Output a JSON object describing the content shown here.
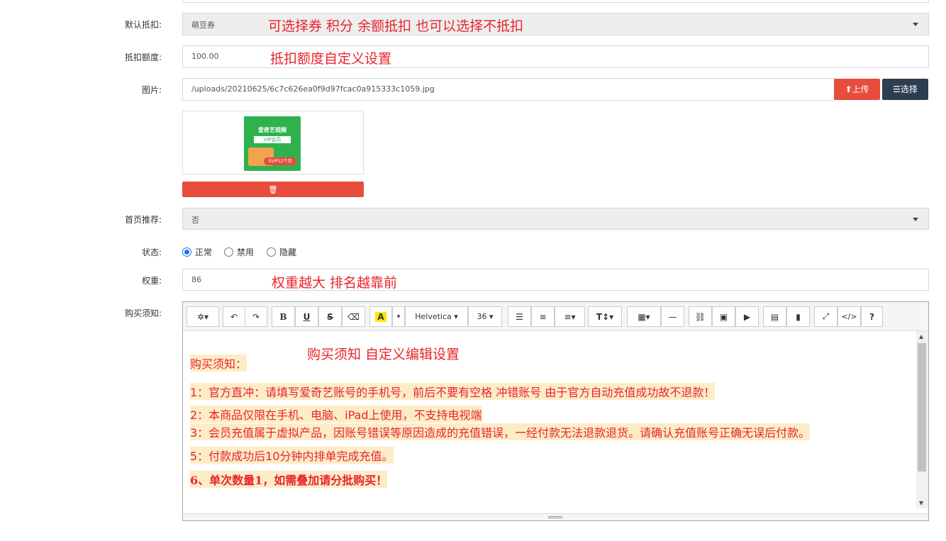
{
  "deduct": {
    "label": "默认抵扣:",
    "value": "萌豆券",
    "note": "可选择券  积分 余额抵扣  也可以选择不抵扣"
  },
  "amount": {
    "label": "抵扣额度:",
    "value": "100.00",
    "note": "抵扣额度自定义设置"
  },
  "image": {
    "label": "图片:",
    "path": "/uploads/20210625/6c7c626ea0f9d97fcac0a915333c1059.jpg",
    "upload_label": "上传",
    "choose_label": "选择",
    "thumb_lines": [
      "爱奇艺视频",
      "VIP会员",
      "SVIP12个月"
    ]
  },
  "recommend": {
    "label": "首页推荐:",
    "value": "否"
  },
  "status": {
    "label": "状态:",
    "options": [
      "正常",
      "禁用",
      "隐藏"
    ],
    "selected": "正常"
  },
  "weight": {
    "label": "权重:",
    "value": "86",
    "note": "权重越大 排名越靠前"
  },
  "notice": {
    "label": "购买须知:",
    "toolbar": {
      "font": "Helvetica",
      "size": "36",
      "bold": "B",
      "underline": "U",
      "strike": "S",
      "highlight": "A",
      "help": "?"
    },
    "annotation": "购买须知   自定义编辑设置",
    "lines": [
      "购买须知：",
      "1：官方直冲：请填写爱奇艺账号的手机号，前后不要有空格 冲错账号 由于官方自动充值成功故不退款！",
      "2：本商品仅限在手机、电脑、iPad上使用，不支持电视端",
      "3：会员充值属于虚拟产品，因账号错误等原因造成的充值错误，一经付款无法退款退货。请确认充值账号正确无误后付款。",
      "5：付款成功后10分钟内排单完成充值。",
      "6、单次数量1，如需叠加请分批购买！"
    ]
  },
  "colors": {
    "danger": "#e74c3c",
    "dark": "#2c3e50",
    "note_red": "#e8242b",
    "highlight": "#fdecc8"
  }
}
